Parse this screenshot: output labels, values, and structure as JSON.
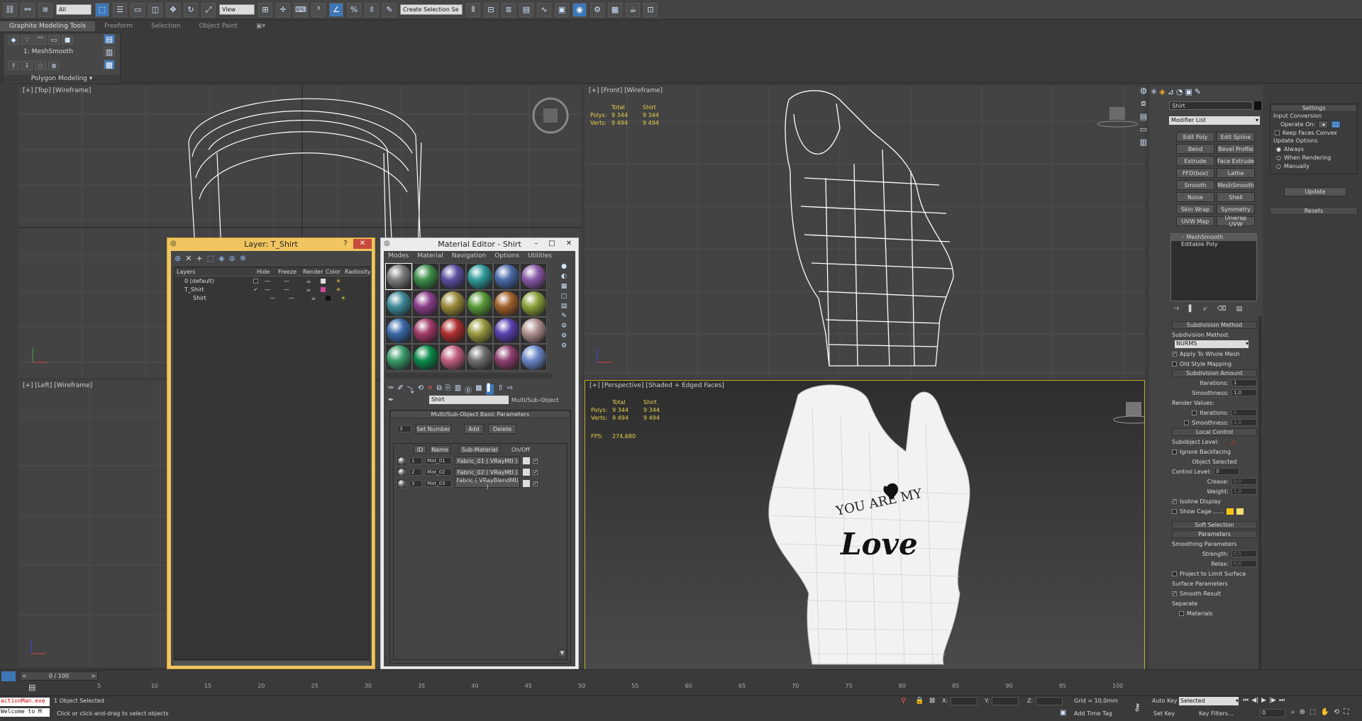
{
  "toolbar": {
    "selection_filter": "All",
    "ref_coord": "View",
    "selection_set_placeholder": "Create Selection Se",
    "icon_names": [
      "select-link-icon",
      "unlink-icon",
      "bind-spacewarp-icon",
      "select-object-icon",
      "select-by-name-icon",
      "rect-region-icon",
      "window-crossing-icon",
      "move-icon",
      "rotate-icon",
      "scale-icon",
      "pivot-icon",
      "select-manipulate-icon",
      "keyboard-shortcut-icon",
      "snaps-toggle-icon",
      "angle-snap-icon",
      "percent-snap-icon",
      "spinner-snap-icon",
      "edit-named-sets-icon",
      "mirror-icon",
      "align-icon",
      "layer-manager-icon",
      "graphite-toggle-icon",
      "curve-editor-icon",
      "schematic-view-icon",
      "material-editor-icon",
      "render-setup-icon",
      "rendered-frame-icon",
      "render-icon",
      "render-iterative-icon"
    ]
  },
  "ribbon": {
    "tabs": [
      "Graphite Modeling Tools",
      "Freeform",
      "Selection",
      "Object Paint"
    ],
    "modifier": "1: MeshSmooth",
    "panel": "Polygon Modeling"
  },
  "viewports": {
    "top": "[+] [Top] [Wireframe]",
    "front": "[+] [Front] [Wireframe]",
    "left": "[+] [Left] [Wireframe]",
    "perspective": "[+] [Perspective] [Shaded + Edged Faces]"
  },
  "stats": {
    "total": "Total",
    "shirt": "Shirt",
    "polys_label": "Polys:",
    "polys_total": "9 344",
    "polys_shirt": "9 344",
    "verts_label": "Verts:",
    "verts_total": "9 494",
    "verts_shirt": "9 494",
    "fps_label": "FPS:",
    "fps": "274,680"
  },
  "artwork": {
    "print_line1": "YOU ARE MY",
    "print_line2": "Love"
  },
  "layer_window": {
    "title": "Layer: T_Shirt",
    "columns": [
      "Layers",
      "Hide",
      "Freeze",
      "Render",
      "Color",
      "Radiosity"
    ],
    "rows": [
      {
        "name": "0 (default)",
        "color": "#e0e0e0"
      },
      {
        "name": "T_Shirt",
        "color": "#d04aa0"
      },
      {
        "name": "Shirt",
        "color": "#111111"
      }
    ]
  },
  "material_editor": {
    "title": "Material Editor - Shirt",
    "menus": [
      "Modes",
      "Material",
      "Navigation",
      "Options",
      "Utilities"
    ],
    "sphere_colors": [
      "#7c7c7c",
      "#3e8f4a",
      "#5a4fa0",
      "#2f9a9a",
      "#4a6aa8",
      "#8a5aa8",
      "#3f8a9a",
      "#8a3f8a",
      "#9a8a3a",
      "#5a9a3a",
      "#a0602a",
      "#8aa03a",
      "#3a6aa8",
      "#a03a6a",
      "#b03030",
      "#9a9a40",
      "#5a40b0",
      "#b09090",
      "#3a9a6a",
      "#0a8a4a",
      "#c06080",
      "#707070",
      "#904070",
      "#6a88c8"
    ],
    "material_name": "Shirt",
    "material_type": "Multi/Sub-Object",
    "rollout": "Multi/Sub-Object Basic Parameters",
    "count": "3",
    "set_number": "Set Number",
    "add": "Add",
    "delete": "Delete",
    "col_id": "ID",
    "col_name": "Name",
    "col_sub": "Sub-Material",
    "col_onoff": "On/Off",
    "rows": [
      {
        "id": "1",
        "name": "Mat_01",
        "sub": "Fabric_01 ( VRayMtl )"
      },
      {
        "id": "2",
        "name": "Mat_02",
        "sub": "Fabric_02 ( VRayMtl )"
      },
      {
        "id": "3",
        "name": "Mat_03",
        "sub": "Fabric ( VRayBlendMtl )"
      }
    ]
  },
  "command_panel": {
    "object_name": "Shirt",
    "modifier_list": "Modifier List",
    "modifier_buttons": [
      "Edit Poly",
      "Edit Spline",
      "Bend",
      "Bevel Profile",
      "Extrude",
      "Face Extrude",
      "FFD(box)",
      "Lathe",
      "Smooth",
      "MeshSmooth",
      "Noise",
      "Shell",
      "Skin Wrap",
      "Symmetry",
      "UVW Map",
      "Unwrap UVW"
    ],
    "stack": [
      "MeshSmooth",
      "Editable Poly"
    ],
    "subdivision_method": "Subdivision Method",
    "subdivision_method_label": "Subdivision Method:",
    "method_value": "NURMS",
    "apply_whole": "Apply To Whole Mesh",
    "old_style": "Old Style Mapping",
    "subdivision_amount": "Subdivision Amount",
    "iterations": "Iterations:",
    "iterations_val": "1",
    "smoothness": "Smoothness:",
    "smoothness_val": "1,0",
    "render_values": "Render Values:",
    "r_iterations_val": "0",
    "r_smoothness_val": "1,0",
    "local_control": "Local Control",
    "subobject_level": "Subobject Level:",
    "ignore_backfacing": "Ignore Backfacing",
    "object_selected": "Object Selected",
    "control_level": "Control Level:",
    "control_level_val": "0",
    "crease": "Crease:",
    "crease_val": "0,0",
    "weight": "Weight:",
    "weight_val": "1,0",
    "isoline": "Isoline Display",
    "show_cage": "Show Cage ......",
    "soft_selection": "Soft Selection",
    "parameters": "Parameters",
    "smoothing_params": "Smoothing Parameters",
    "strength": "Strength:",
    "strength_val": "0,5",
    "relax": "Relax:",
    "relax_val": "0,0",
    "project": "Project to Limit Surface",
    "surface_params": "Surface Parameters",
    "smooth_result": "Smooth Result",
    "separate": "Separate",
    "materials": "Materials"
  },
  "settings_panel": {
    "title": "Settings",
    "input_conversion": "Input Conversion",
    "operate_on": "Operate On:",
    "keep_faces": "Keep Faces Convex",
    "update_options": "Update Options",
    "always": "Always",
    "when_rendering": "When Rendering",
    "manually": "Manually",
    "update": "Update",
    "resets": "Resets"
  },
  "timeline": {
    "frame": "0 / 100",
    "ticks": [
      "5",
      "10",
      "15",
      "20",
      "25",
      "30",
      "35",
      "40",
      "45",
      "50",
      "55",
      "60",
      "65",
      "70",
      "75",
      "80",
      "85",
      "90",
      "95",
      "100"
    ]
  },
  "status": {
    "maxscript": "actionMan.exe",
    "welcome": "Welcome to M",
    "selected": "1 Object Selected",
    "prompt": "Click or click-and-drag to select objects",
    "x_label": "X:",
    "y_label": "Y:",
    "z_label": "Z:",
    "grid": "Grid = 10,0mm",
    "add_time_tag": "Add Time Tag",
    "auto_key": "Auto Key",
    "set_key": "Set Key",
    "key_mode": "Selected",
    "key_filters": "Key Filters...",
    "frame_field": "0"
  }
}
